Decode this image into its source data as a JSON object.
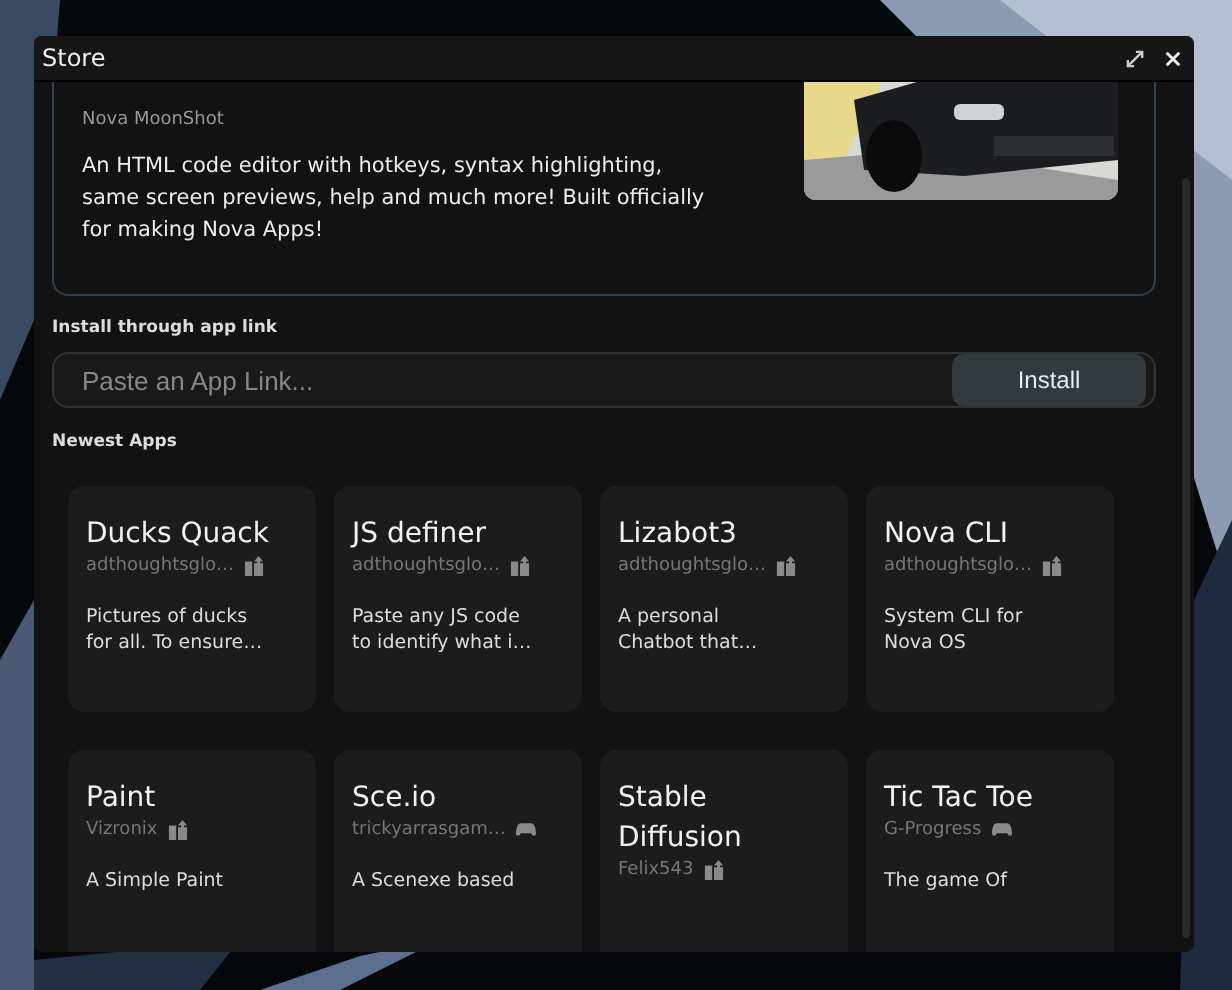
{
  "window": {
    "title": "Store"
  },
  "featured": {
    "author": "Nova MoonShot",
    "description": "An HTML code editor with hotkeys, syntax highlighting,\nsame screen previews, help and much more! Built officially\nfor making Nova Apps!"
  },
  "install": {
    "label": "Install through app link",
    "placeholder": "Paste an App Link...",
    "button": "Install"
  },
  "newest": {
    "heading": "Newest Apps",
    "apps": [
      {
        "name": "Ducks Quack",
        "author": "adthoughtsglo…",
        "kind": "app",
        "description": "Pictures of ducks\nfor all. To ensure…"
      },
      {
        "name": "JS definer",
        "author": "adthoughtsglo…",
        "kind": "app",
        "description": "Paste any JS code\nto identify what i…"
      },
      {
        "name": "Lizabot3",
        "author": "adthoughtsglo…",
        "kind": "app",
        "description": "A personal\nChatbot that…"
      },
      {
        "name": "Nova CLI",
        "author": "adthoughtsglo…",
        "kind": "app",
        "description": "System CLI for\nNova OS"
      },
      {
        "name": "Paint",
        "author": "Vizronix",
        "kind": "app",
        "description": "A Simple Paint"
      },
      {
        "name": "Sce.io",
        "author": "trickyarrasgam…",
        "kind": "game",
        "description": "A Scenexe based"
      },
      {
        "name": "Stable\nDiffusion",
        "author": "Felix543",
        "kind": "app"
      },
      {
        "name": "Tic Tac Toe",
        "author": "G-Progress",
        "kind": "game",
        "description": "The game Of"
      }
    ]
  }
}
